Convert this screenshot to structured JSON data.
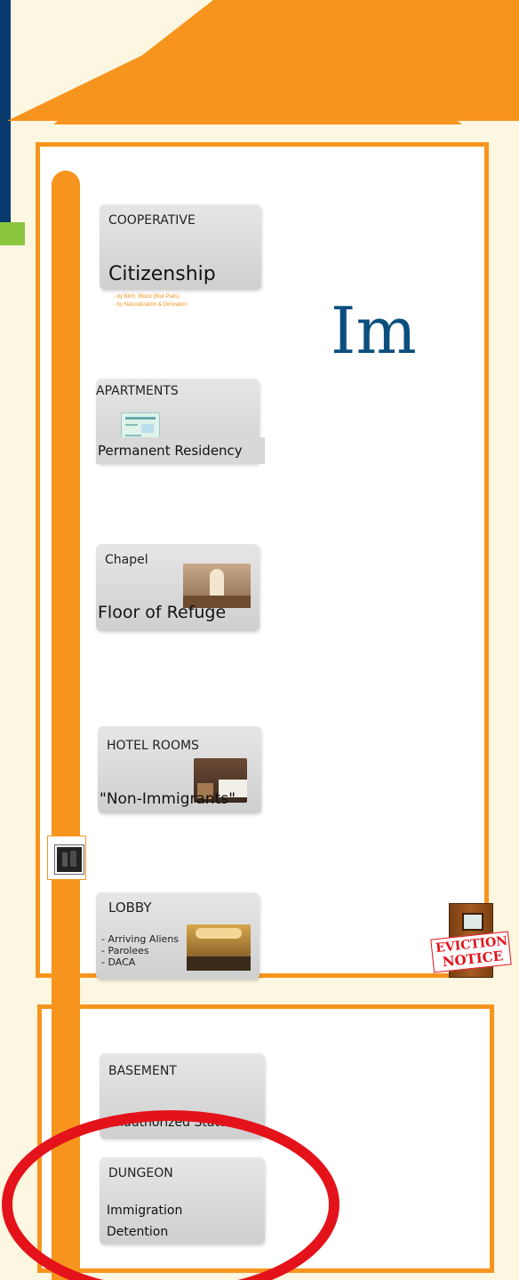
{
  "title_partial": "Im",
  "floors": {
    "cooperative": {
      "label": "COOPERATIVE",
      "title": "Citizenship",
      "notes": [
        "- by Birth: Blood (Blut Plats)",
        "- by Naturalization & Derivation"
      ]
    },
    "apartments": {
      "label": "APARTMENTS",
      "title": "Permanent Residency"
    },
    "chapel": {
      "label": "Chapel",
      "title": "Floor of Refuge"
    },
    "hotel": {
      "label": "HOTEL ROOMS",
      "title": "\"Non-Immigrants\""
    },
    "lobby": {
      "label": "LOBBY",
      "items": [
        "- Arriving Aliens",
        "- Parolees",
        "- DACA"
      ]
    },
    "basement": {
      "label": "BASEMENT",
      "title": "Unauthorized Status"
    },
    "dungeon": {
      "label": "DUNGEON",
      "title_lines": [
        "Immigration",
        "Detention"
      ]
    }
  },
  "eviction": {
    "line1": "EVICTION",
    "line2": "NOTICE"
  },
  "colors": {
    "orange": "#f7941d",
    "navy": "#0b3a6e",
    "green": "#8cc63f",
    "red": "#e3121b",
    "title_blue": "#0b4f7e"
  }
}
